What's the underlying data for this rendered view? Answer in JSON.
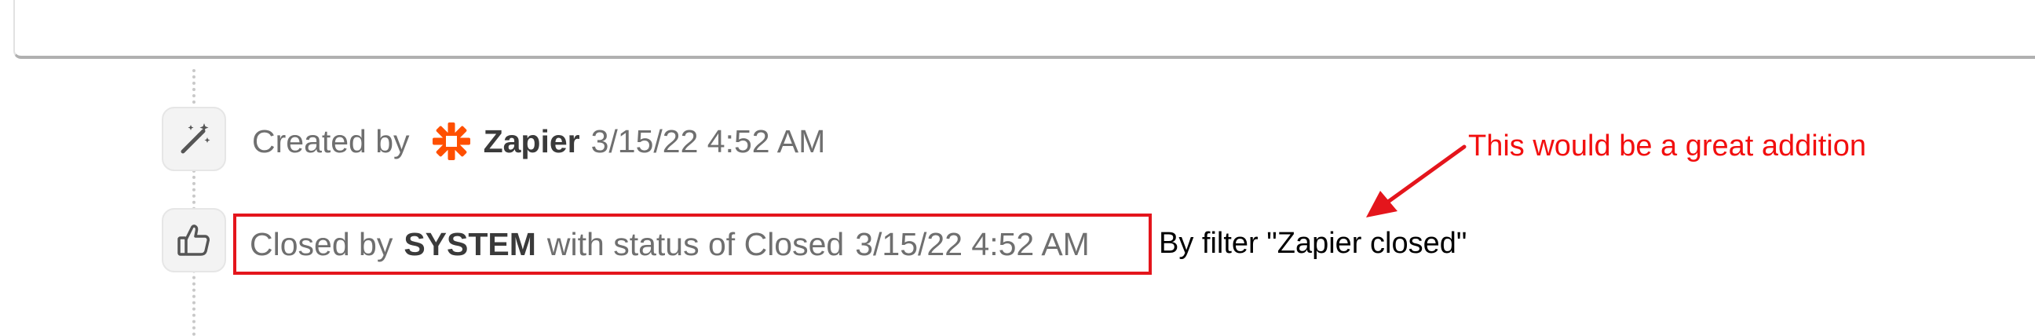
{
  "timeline": {
    "created_event": {
      "prefix": "Created by",
      "actor": "Zapier",
      "timestamp": "3/15/22 4:52 AM",
      "icon": "magic-wand-icon",
      "actor_icon": "zapier-logo"
    },
    "closed_event": {
      "prefix": "Closed by",
      "actor": "SYSTEM",
      "middle": "with status of Closed",
      "timestamp": "3/15/22 4:52 AM",
      "icon": "thumbs-up-icon"
    }
  },
  "annotations": {
    "filter_note": "By filter \"Zapier closed\"",
    "suggestion": "This would be a great addition"
  },
  "colors": {
    "highlight": "#e4151c",
    "annotation_text": "#f20f0f",
    "zapier_brand": "#ff4f00"
  }
}
